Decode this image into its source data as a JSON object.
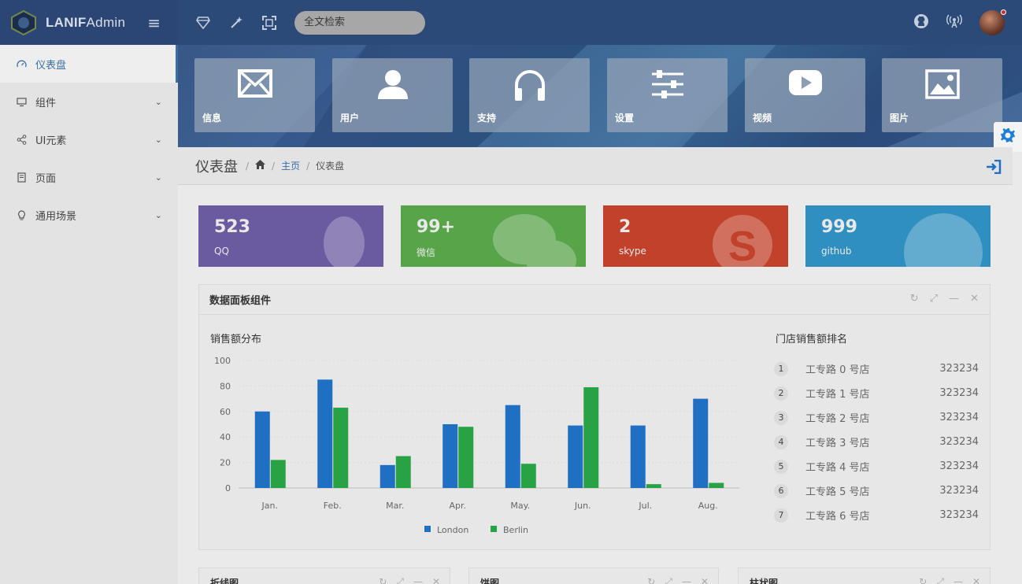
{
  "brand": {
    "name_bold": "LANIF",
    "name_rest": "Admin"
  },
  "search": {
    "placeholder": "全文检索"
  },
  "sidebar": {
    "items": [
      {
        "label": "仪表盘",
        "icon": "dashboard-icon",
        "active": true
      },
      {
        "label": "组件",
        "icon": "monitor-icon"
      },
      {
        "label": "UI元素",
        "icon": "share-icon"
      },
      {
        "label": "页面",
        "icon": "page-icon"
      },
      {
        "label": "通用场景",
        "icon": "bulb-icon"
      }
    ]
  },
  "tiles": [
    {
      "label": "信息",
      "icon": "envelope-icon"
    },
    {
      "label": "用户",
      "icon": "user-icon"
    },
    {
      "label": "支持",
      "icon": "headphones-icon"
    },
    {
      "label": "设置",
      "icon": "sliders-icon"
    },
    {
      "label": "视频",
      "icon": "play-icon"
    },
    {
      "label": "图片",
      "icon": "image-icon"
    }
  ],
  "header": {
    "title": "仪表盘",
    "crumb_home": "主页",
    "crumb_current": "仪表盘"
  },
  "stats": [
    {
      "value": "523",
      "label": "QQ",
      "color": "#6a5aa0"
    },
    {
      "value": "99+",
      "label": "微信",
      "color": "#58a449"
    },
    {
      "value": "2",
      "label": "skype",
      "color": "#c1412b"
    },
    {
      "value": "999",
      "label": "github",
      "color": "#2f8fc0"
    }
  ],
  "panel": {
    "title": "数据面板组件",
    "chart_title": "销售额分布",
    "rank_title": "门店销售额排名",
    "ranking": [
      {
        "idx": "1",
        "name": "工专路 0 号店",
        "value": "323234"
      },
      {
        "idx": "2",
        "name": "工专路 1 号店",
        "value": "323234"
      },
      {
        "idx": "3",
        "name": "工专路 2 号店",
        "value": "323234"
      },
      {
        "idx": "4",
        "name": "工专路 3 号店",
        "value": "323234"
      },
      {
        "idx": "5",
        "name": "工专路 4 号店",
        "value": "323234"
      },
      {
        "idx": "6",
        "name": "工专路 5 号店",
        "value": "323234"
      },
      {
        "idx": "7",
        "name": "工专路 6 号店",
        "value": "323234"
      }
    ]
  },
  "chart_data": {
    "type": "bar",
    "categories": [
      "Jan.",
      "Feb.",
      "Mar.",
      "Apr.",
      "May.",
      "Jun.",
      "Jul.",
      "Aug."
    ],
    "series": [
      {
        "name": "London",
        "color": "#1f6fc2",
        "values": [
          60,
          85,
          18,
          50,
          65,
          49,
          49,
          70
        ]
      },
      {
        "name": "Berlin",
        "color": "#28a245",
        "values": [
          22,
          63,
          25,
          48,
          19,
          79,
          3,
          4
        ]
      }
    ],
    "yticks": [
      0,
      20,
      40,
      60,
      80,
      100
    ],
    "ylim": [
      0,
      100
    ],
    "legend": "bottom"
  },
  "bottom_panels": [
    {
      "title": "折线图"
    },
    {
      "title": "饼图"
    },
    {
      "title": "柱状图"
    }
  ],
  "colors": {
    "topbar": "#2c4a78",
    "accent": "#3a6ea5"
  }
}
